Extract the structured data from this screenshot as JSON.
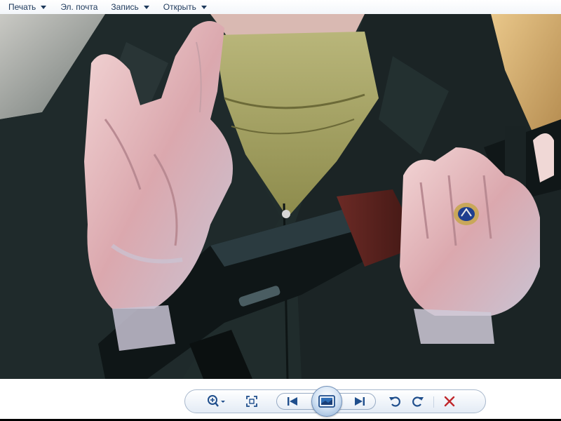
{
  "menu": {
    "items": [
      {
        "label": "Печать",
        "has_dropdown": true
      },
      {
        "label": "Эл. почта",
        "has_dropdown": false
      },
      {
        "label": "Запись",
        "has_dropdown": true
      },
      {
        "label": "Открыть",
        "has_dropdown": true
      }
    ]
  },
  "toolbar": {
    "buttons": [
      {
        "name": "zoom",
        "icon": "magnifier-plus-icon",
        "has_dropdown": true
      },
      {
        "name": "actual-size",
        "icon": "fit-window-icon"
      },
      {
        "name": "previous",
        "icon": "skip-previous-icon"
      },
      {
        "name": "slideshow",
        "icon": "slideshow-icon"
      },
      {
        "name": "next",
        "icon": "skip-next-icon"
      },
      {
        "name": "rotate-left",
        "icon": "rotate-counterclockwise-icon"
      },
      {
        "name": "rotate-right",
        "icon": "rotate-clockwise-icon"
      },
      {
        "name": "delete",
        "icon": "delete-x-icon"
      }
    ]
  },
  "colors": {
    "menu_text": "#1e395b",
    "icon_blue": "#1f4e8c",
    "delete_red": "#c0282c",
    "photo_dark": "#1b2626",
    "skin": "#e6b8b4",
    "olive_shirt": "#9c9a5a"
  }
}
